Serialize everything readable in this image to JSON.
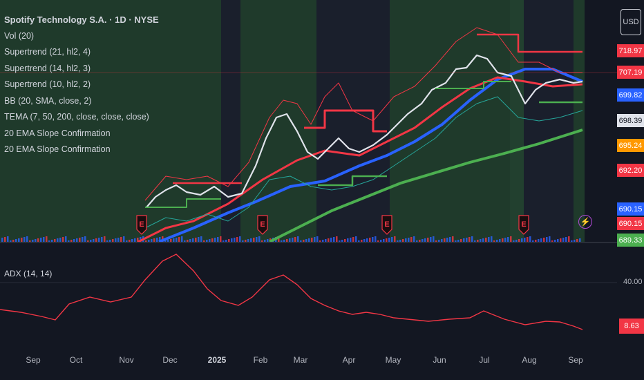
{
  "header": {
    "title": "Spotify Technology S.A. · 1D · NYSE",
    "currency_button": "USD"
  },
  "legend": [
    "Vol (20)",
    "Supertrend (21, hl2, 4)",
    "Supertrend (14, hl2, 3)",
    "Supertrend (10, hl2, 2)",
    "BB (20, SMA, close, 2)",
    "TEMA (7, 50, 200, close, close, close)",
    "20 EMA Slope Confirmation",
    "20 EMA Slope Confirmation"
  ],
  "price_tags": [
    {
      "text": "718.97",
      "color": "#f23645"
    },
    {
      "text": "707.19",
      "color": "#f23645"
    },
    {
      "text": "699.82",
      "color": "#2962ff"
    },
    {
      "text": "698.39",
      "color": "#e0e3eb"
    },
    {
      "text": "695.24",
      "color": "#ff9800"
    },
    {
      "text": "692.20",
      "color": "#f23645"
    },
    {
      "text": "690.15",
      "color": "#2962ff"
    },
    {
      "text": "690.15",
      "color": "#f23645"
    },
    {
      "text": "689.33",
      "color": "#4caf50"
    }
  ],
  "adx_panel": {
    "label": "ADX (14, 14)",
    "y_tick": "40.00",
    "last_value": "8.63",
    "line_color": "#f23645"
  },
  "x_axis": {
    "ticks": [
      "Sep",
      "Oct",
      "Nov",
      "Dec",
      "2025",
      "Feb",
      "Mar",
      "Apr",
      "May",
      "Jun",
      "Jul",
      "Aug",
      "Sep"
    ]
  },
  "chart_data": [
    {
      "type": "line",
      "title": "Spotify Technology S.A. · 1D · NYSE",
      "x": [
        "Nov",
        "Dec",
        "2025",
        "Feb",
        "Mar",
        "Apr",
        "May",
        "Jun",
        "Jul",
        "Aug",
        "Sep"
      ],
      "series": [
        {
          "name": "Supertrend (21, hl2, 4)",
          "color": "#f23645"
        },
        {
          "name": "BB (20, SMA, close, 2)",
          "color": "#2962ff"
        },
        {
          "name": "TEMA (7, 50, 200, close, close, close)",
          "color": "#4caf50"
        }
      ],
      "last_values": [
        718.97,
        707.19,
        699.82,
        698.39,
        695.24,
        692.2,
        690.15,
        690.15,
        689.33
      ],
      "y_axis_unit": "USD"
    },
    {
      "type": "line",
      "title": "ADX (14, 14)",
      "x": [
        "Sep",
        "Oct",
        "Nov",
        "Dec",
        "2025",
        "Feb",
        "Mar",
        "Apr",
        "May",
        "Jun",
        "Jul",
        "Aug",
        "Sep"
      ],
      "series": [
        {
          "name": "ADX (14, 14)",
          "color": "#f23645"
        }
      ],
      "gridlines": [
        40
      ],
      "last_value": 8.63
    }
  ]
}
